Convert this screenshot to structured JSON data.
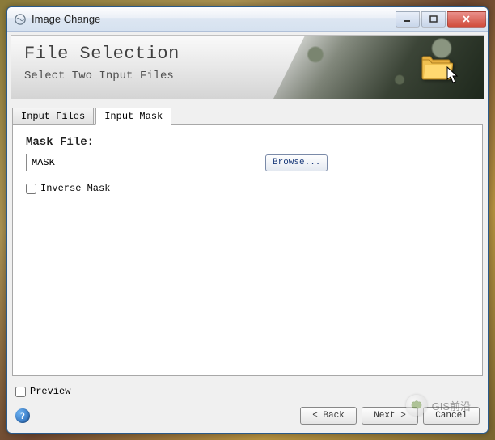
{
  "window": {
    "title": "Image Change"
  },
  "header": {
    "title": "File Selection",
    "subtitle": "Select Two Input Files"
  },
  "tabs": {
    "input_files": "Input Files",
    "input_mask": "Input Mask"
  },
  "panel": {
    "mask_file_label": "Mask File:",
    "mask_file_value": "MASK",
    "browse_label": "Browse...",
    "inverse_mask_label": "Inverse Mask"
  },
  "bottom": {
    "preview_label": "Preview"
  },
  "footer": {
    "help": "?",
    "back": "< Back",
    "next": "Next >",
    "cancel": "Cancel"
  },
  "watermark": {
    "text": "GIS前沿"
  }
}
